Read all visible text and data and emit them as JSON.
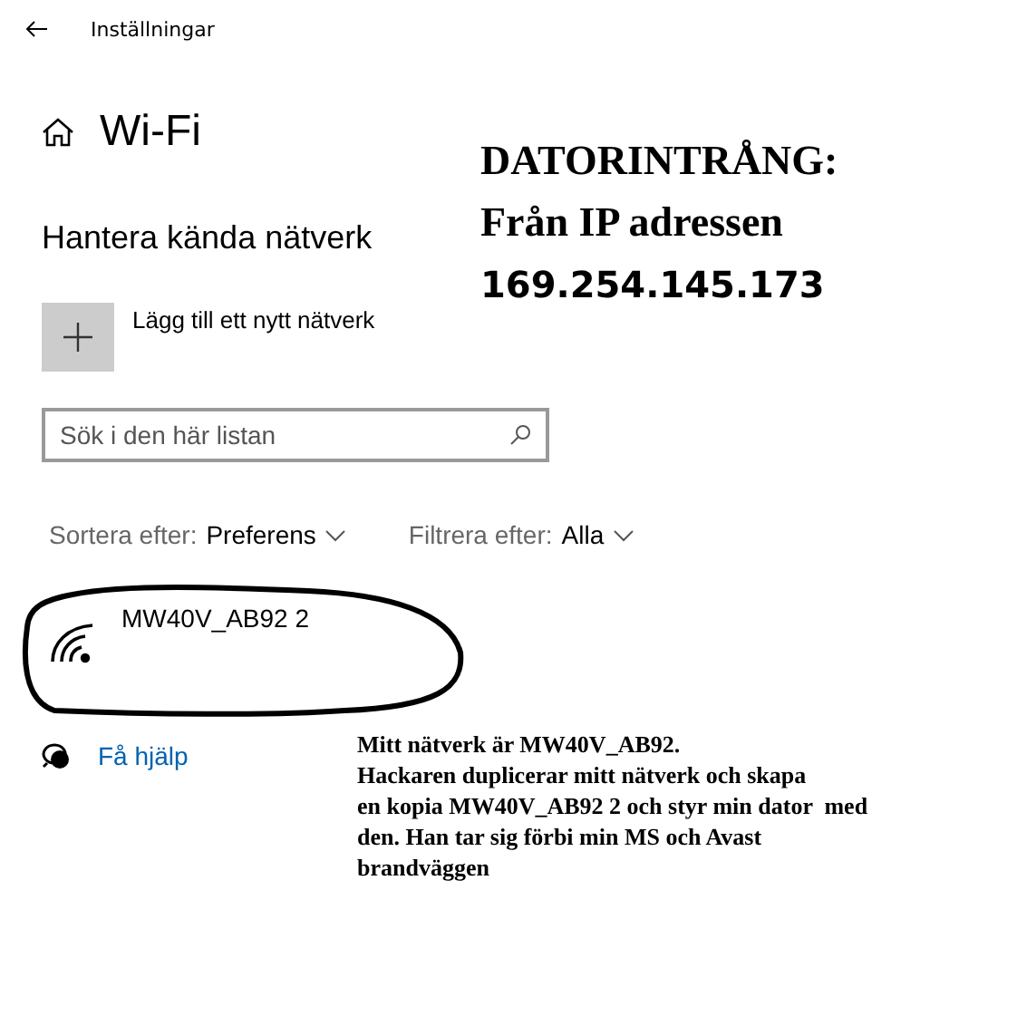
{
  "header": {
    "title": "Inställningar"
  },
  "page": {
    "title": "Wi-Fi"
  },
  "section_title": "Hantera kända nätverk",
  "add_network": {
    "label": "Lägg till ett nytt nätverk"
  },
  "search": {
    "placeholder": "Sök i den här listan"
  },
  "sort": {
    "label": "Sortera efter:",
    "value": "Preferens"
  },
  "filter": {
    "label": "Filtrera efter:",
    "value": "Alla"
  },
  "networks": [
    {
      "name": "MW40V_AB92 2"
    }
  ],
  "help_link": "Få hjälp",
  "annotations": [
    {
      "kind": "heading",
      "lines": [
        {
          "text": "DATORINTRÅNG:",
          "kind": "serif"
        },
        {
          "text": "Från IP adressen",
          "kind": "serif"
        },
        {
          "text": "169.254.145.173",
          "kind": "sans"
        }
      ]
    },
    {
      "kind": "note",
      "lines": [
        {
          "text": "Mitt nätverk är MW40V_AB92.",
          "kind": "serif"
        },
        {
          "text": "Hackaren duplicerar mitt nätverk och skapa",
          "kind": "serif"
        },
        {
          "text": "en kopia MW40V_AB92 2 och styr min dator  med",
          "kind": "serif"
        },
        {
          "text": "den. Han tar sig förbi min MS och Avast",
          "kind": "serif"
        },
        {
          "text": "brandväggen",
          "kind": "serif"
        }
      ]
    }
  ]
}
